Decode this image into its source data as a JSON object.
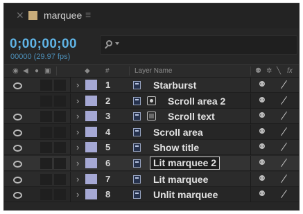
{
  "tab": {
    "title": "marquee",
    "close_icon": "close-icon",
    "menu_icon": "hamburger-menu-icon",
    "swatch_color": "#c9ad7b"
  },
  "time": {
    "timecode": "0;00;00;00",
    "frames_fps": "00000 (29.97 fps)"
  },
  "search": {
    "icon": "search-icon",
    "value": ""
  },
  "columns": {
    "layer_name": "Layer Name",
    "number": "#",
    "fx_partial": "fx"
  },
  "label_color": "#a5a8d4",
  "accent_color": "#5fb4e6",
  "layers": [
    {
      "number": "1",
      "name": "Starburst",
      "visible": true,
      "fx_icon": "",
      "editing": false
    },
    {
      "number": "2",
      "name": "Scroll area 2",
      "visible": false,
      "fx_icon": "dot",
      "editing": false
    },
    {
      "number": "3",
      "name": "Scroll text",
      "visible": true,
      "fx_icon": "img",
      "editing": false
    },
    {
      "number": "4",
      "name": "Scroll area",
      "visible": true,
      "fx_icon": "",
      "editing": false
    },
    {
      "number": "5",
      "name": "Show title",
      "visible": true,
      "fx_icon": "",
      "editing": false
    },
    {
      "number": "6",
      "name": "Lit marquee 2",
      "visible": true,
      "fx_icon": "",
      "editing": true
    },
    {
      "number": "7",
      "name": "Lit marquee",
      "visible": true,
      "fx_icon": "",
      "editing": false
    },
    {
      "number": "8",
      "name": "Unlit marquee",
      "visible": true,
      "fx_icon": "",
      "editing": false
    }
  ]
}
